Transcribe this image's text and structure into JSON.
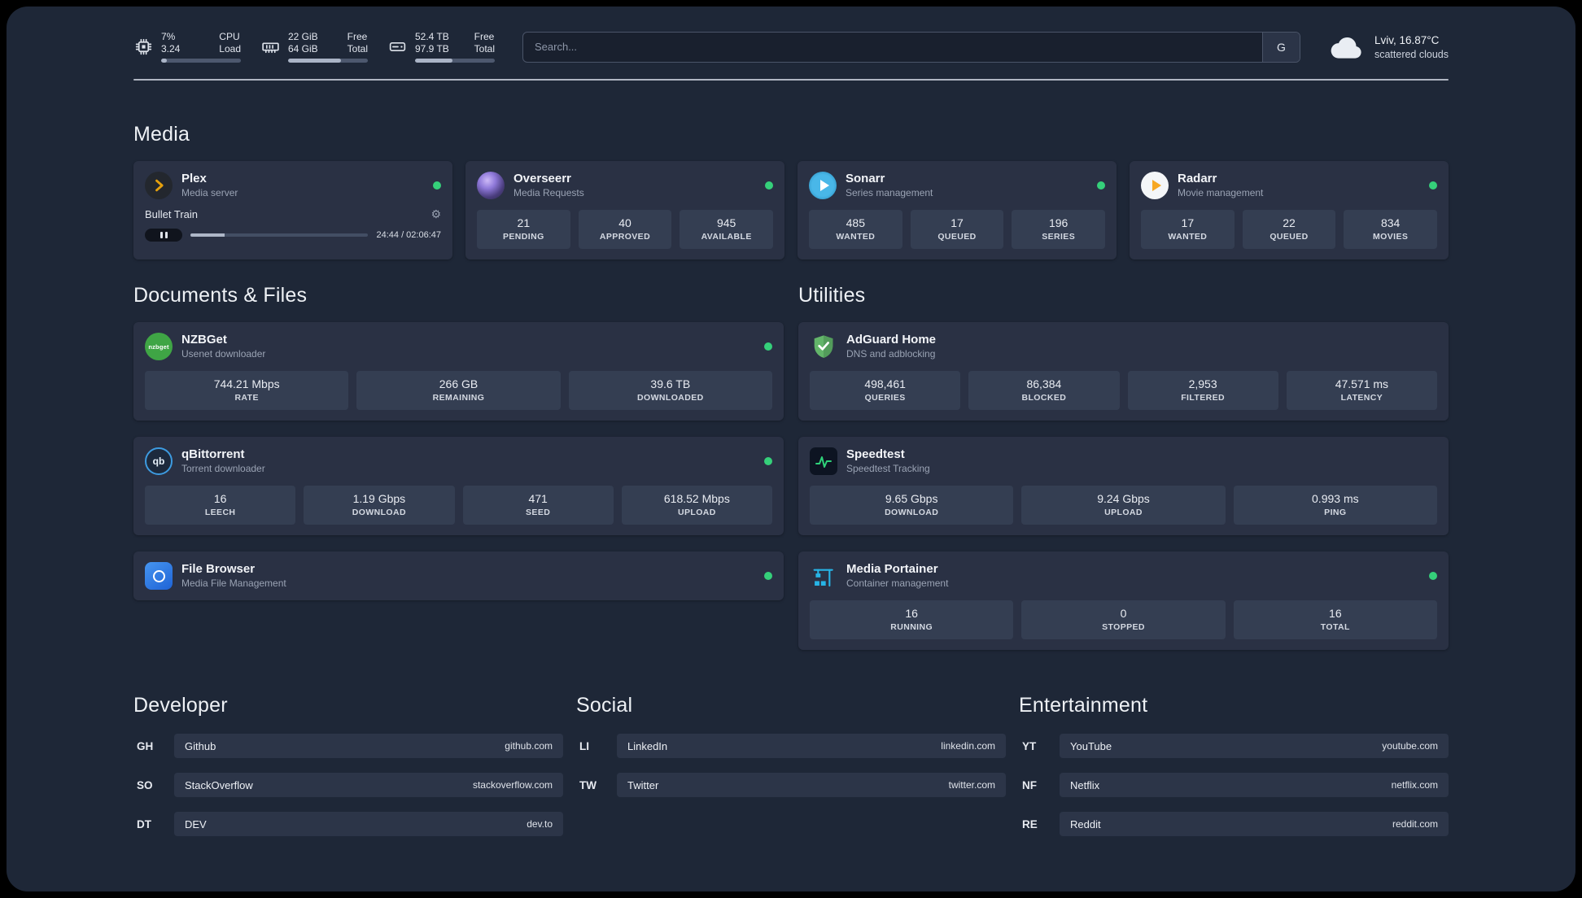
{
  "colors": {
    "status_online": "#35d07a",
    "plex_gold": "#e5a00d",
    "adguard_green": "#63b56a",
    "speedtest_green": "#2fd27a",
    "portainer_blue": "#27b4e6"
  },
  "topbar": {
    "cpu": {
      "percent": "7%",
      "load": "3.24",
      "label1": "CPU",
      "label2": "Load",
      "progress": 7
    },
    "ram": {
      "free": "22 GiB",
      "total": "64 GiB",
      "label1": "Free",
      "label2": "Total",
      "progress": 66
    },
    "disk": {
      "free": "52.4 TB",
      "total": "97.9 TB",
      "label1": "Free",
      "label2": "Total",
      "progress": 47
    },
    "search": {
      "placeholder": "Search...",
      "engine_button": "G"
    },
    "weather": {
      "location": "Lviv, 16.87°C",
      "condition": "scattered clouds"
    }
  },
  "media": {
    "heading": "Media",
    "plex": {
      "title": "Plex",
      "subtitle": "Media server",
      "now_playing": "Bullet Train",
      "time": "24:44 / 02:06:47",
      "progress": 19
    },
    "overseerr": {
      "title": "Overseerr",
      "subtitle": "Media Requests",
      "stats": [
        {
          "value": "21",
          "label": "PENDING"
        },
        {
          "value": "40",
          "label": "APPROVED"
        },
        {
          "value": "945",
          "label": "AVAILABLE"
        }
      ]
    },
    "sonarr": {
      "title": "Sonarr",
      "subtitle": "Series management",
      "stats": [
        {
          "value": "485",
          "label": "WANTED"
        },
        {
          "value": "17",
          "label": "QUEUED"
        },
        {
          "value": "196",
          "label": "SERIES"
        }
      ]
    },
    "radarr": {
      "title": "Radarr",
      "subtitle": "Movie management",
      "stats": [
        {
          "value": "17",
          "label": "WANTED"
        },
        {
          "value": "22",
          "label": "QUEUED"
        },
        {
          "value": "834",
          "label": "MOVIES"
        }
      ]
    }
  },
  "documents": {
    "heading": "Documents & Files",
    "nzbget": {
      "title": "NZBGet",
      "subtitle": "Usenet downloader",
      "icon_text": "nzbget",
      "stats": [
        {
          "value": "744.21 Mbps",
          "label": "RATE"
        },
        {
          "value": "266 GB",
          "label": "REMAINING"
        },
        {
          "value": "39.6 TB",
          "label": "DOWNLOADED"
        }
      ]
    },
    "qbittorrent": {
      "title": "qBittorrent",
      "subtitle": "Torrent downloader",
      "icon_text": "qb",
      "stats": [
        {
          "value": "16",
          "label": "LEECH"
        },
        {
          "value": "1.19 Gbps",
          "label": "DOWNLOAD"
        },
        {
          "value": "471",
          "label": "SEED"
        },
        {
          "value": "618.52 Mbps",
          "label": "UPLOAD"
        }
      ]
    },
    "filebrowser": {
      "title": "File Browser",
      "subtitle": "Media File Management"
    }
  },
  "utilities": {
    "heading": "Utilities",
    "adguard": {
      "title": "AdGuard Home",
      "subtitle": "DNS and adblocking",
      "stats": [
        {
          "value": "498,461",
          "label": "QUERIES"
        },
        {
          "value": "86,384",
          "label": "BLOCKED"
        },
        {
          "value": "2,953",
          "label": "FILTERED"
        },
        {
          "value": "47.571 ms",
          "label": "LATENCY"
        }
      ]
    },
    "speedtest": {
      "title": "Speedtest",
      "subtitle": "Speedtest Tracking",
      "stats": [
        {
          "value": "9.65 Gbps",
          "label": "DOWNLOAD"
        },
        {
          "value": "9.24 Gbps",
          "label": "UPLOAD"
        },
        {
          "value": "0.993 ms",
          "label": "PING"
        }
      ]
    },
    "portainer": {
      "title": "Media Portainer",
      "subtitle": "Container management",
      "stats": [
        {
          "value": "16",
          "label": "RUNNING"
        },
        {
          "value": "0",
          "label": "STOPPED"
        },
        {
          "value": "16",
          "label": "TOTAL"
        }
      ]
    }
  },
  "bookmarks": {
    "developer": {
      "heading": "Developer",
      "items": [
        {
          "abbr": "GH",
          "name": "Github",
          "url": "github.com"
        },
        {
          "abbr": "SO",
          "name": "StackOverflow",
          "url": "stackoverflow.com"
        },
        {
          "abbr": "DT",
          "name": "DEV",
          "url": "dev.to"
        }
      ]
    },
    "social": {
      "heading": "Social",
      "items": [
        {
          "abbr": "LI",
          "name": "LinkedIn",
          "url": "linkedin.com"
        },
        {
          "abbr": "TW",
          "name": "Twitter",
          "url": "twitter.com"
        }
      ]
    },
    "entertainment": {
      "heading": "Entertainment",
      "items": [
        {
          "abbr": "YT",
          "name": "YouTube",
          "url": "youtube.com"
        },
        {
          "abbr": "NF",
          "name": "Netflix",
          "url": "netflix.com"
        },
        {
          "abbr": "RE",
          "name": "Reddit",
          "url": "reddit.com"
        }
      ]
    }
  }
}
